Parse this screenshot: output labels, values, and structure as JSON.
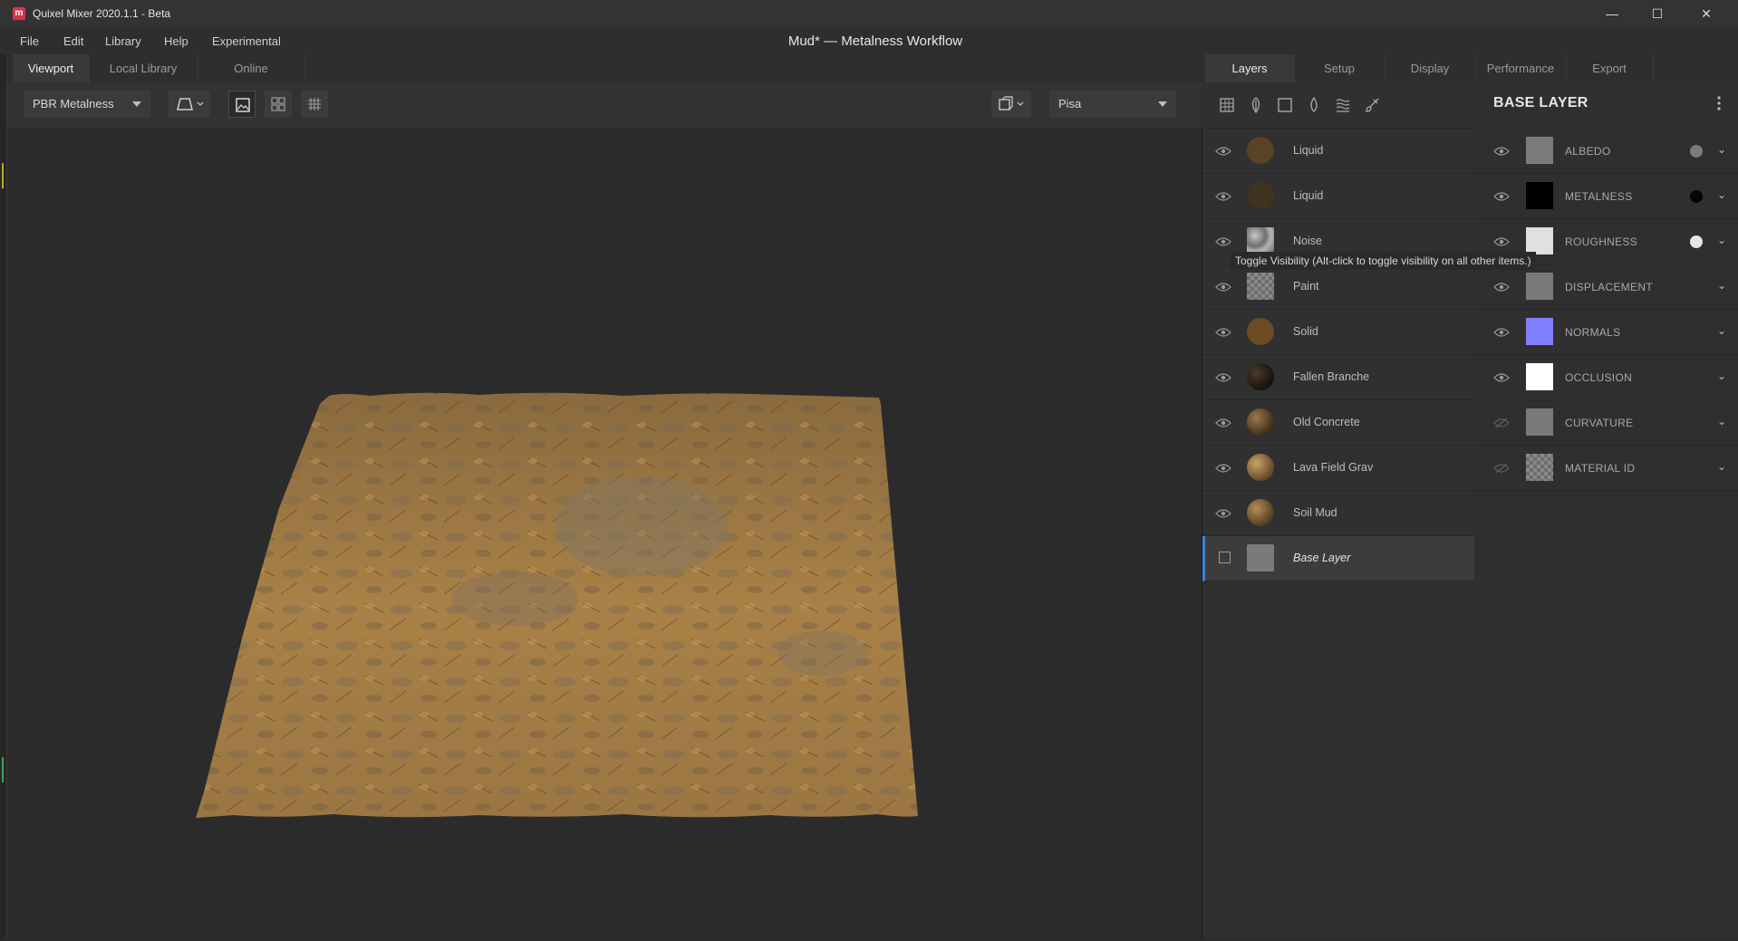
{
  "app": {
    "title": "Quixel Mixer 2020.1.1 - Beta",
    "logo_letter": "m",
    "document_title": "Mud* — Metalness Workflow"
  },
  "window_controls": {
    "minimize": "—",
    "maximize": "☐",
    "close": "✕"
  },
  "menu": [
    "File",
    "Edit",
    "Library",
    "Help",
    "Experimental"
  ],
  "viewport_tabs": [
    "Viewport",
    "Local Library",
    "Online"
  ],
  "toolbar": {
    "render_mode": "PBR Metalness",
    "environment": "Pisa"
  },
  "right_tabs": [
    "Layers",
    "Setup",
    "Display",
    "Performance",
    "Export"
  ],
  "layers": [
    {
      "name": "Liquid",
      "thumb": "#5a4226"
    },
    {
      "name": "Liquid",
      "thumb": "#3f321e"
    },
    {
      "name": "Noise",
      "thumb": "noise"
    },
    {
      "name": "Paint",
      "thumb": "checker"
    },
    {
      "name": "Solid",
      "thumb": "#6b4c24"
    },
    {
      "name": "Fallen Branche",
      "thumb": "#2a2016"
    },
    {
      "name": "Old Concrete",
      "thumb": "#5b4630"
    },
    {
      "name": "Lava Field Grav",
      "thumb": "#7d6238"
    },
    {
      "name": "Soil Mud",
      "thumb": "#6e5532"
    },
    {
      "name": "Base Layer",
      "thumb": "#7a7a7a"
    }
  ],
  "tooltip": "Toggle Visibility (Alt-click to toggle visibility on all other items.)",
  "properties": {
    "title": "BASE LAYER",
    "channels": [
      {
        "label": "ALBEDO",
        "swatch": "#7b7b7b",
        "dot": "#7b7b7b",
        "visible": true
      },
      {
        "label": "METALNESS",
        "swatch": "#000000",
        "dot": "#050505",
        "visible": true
      },
      {
        "label": "ROUGHNESS",
        "swatch": "#e0e0e0",
        "dot": "#e6e6e6",
        "visible": true
      },
      {
        "label": "DISPLACEMENT",
        "swatch": "#7a7a7a",
        "dot": "",
        "visible": true
      },
      {
        "label": "NORMALS",
        "swatch": "#8080ff",
        "dot": "",
        "visible": true
      },
      {
        "label": "OCCLUSION",
        "swatch": "#ffffff",
        "dot": "",
        "visible": true
      },
      {
        "label": "CURVATURE",
        "swatch": "#7a7a7a",
        "dot": "",
        "visible": false
      },
      {
        "label": "MATERIAL ID",
        "swatch": "checker",
        "dot": "",
        "visible": false
      }
    ]
  },
  "colors": {
    "accent": "#3b82d6",
    "terrain": "#a27a45"
  }
}
